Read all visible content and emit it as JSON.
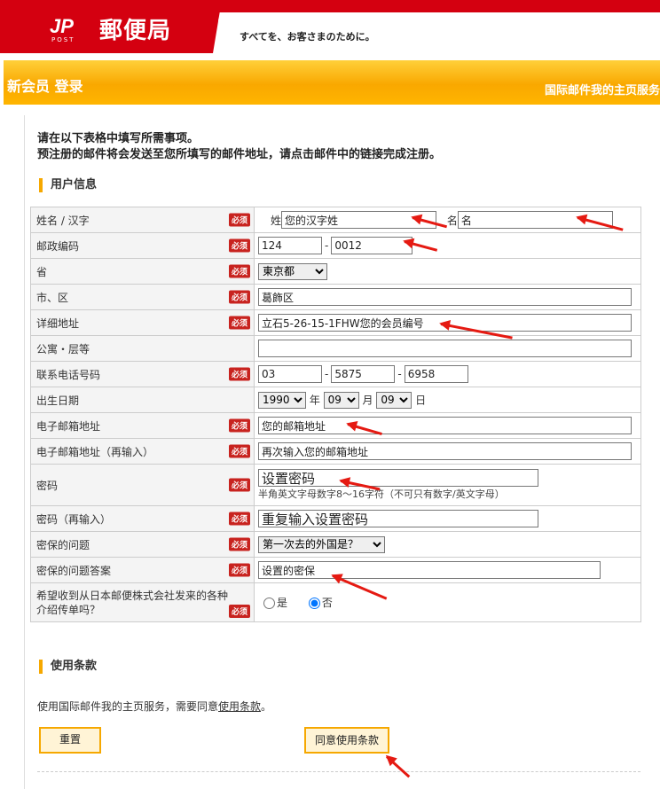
{
  "header": {
    "logo_mark": "JP",
    "logo_post": "POST",
    "logo_name": "郵便局",
    "slogan": "すべてを、お客さまのために。",
    "page_title": "新会员 登录",
    "right_link": "国际邮件我的主页服务"
  },
  "intro": {
    "line1": "请在以下表格中填写所需事项。",
    "line2": "预注册的邮件将会发送至您所填写的邮件地址，请点击邮件中的链接完成注册。"
  },
  "section_user": "用户信息",
  "required_label": "必须",
  "fields": {
    "name": {
      "label": "姓名 / 汉字",
      "last_prefix": "姓",
      "last_value": "您的汉字姓",
      "first_prefix": "名",
      "first_value": "名"
    },
    "postal": {
      "label": "邮政编码",
      "part1": "124",
      "part2": "0012",
      "sep": "-"
    },
    "prefecture": {
      "label": "省",
      "value": "東京都"
    },
    "city": {
      "label": "市、区",
      "value": "葛飾区"
    },
    "address": {
      "label": "详细地址",
      "value": "立石5-26-15-1FHW您的会员编号"
    },
    "apartment": {
      "label": "公寓・层等",
      "value": ""
    },
    "phone": {
      "label": "联系电话号码",
      "part1": "03",
      "part2": "5875",
      "part3": "6958",
      "sep": "-"
    },
    "birth": {
      "label": "出生日期",
      "year": "1990",
      "year_unit": "年",
      "month": "09",
      "month_unit": "月",
      "day": "09",
      "day_unit": "日"
    },
    "email": {
      "label": "电子邮箱地址",
      "value": "您的邮箱地址"
    },
    "email_confirm": {
      "label": "电子邮箱地址（再输入）",
      "value": "再次输入您的邮箱地址"
    },
    "password": {
      "label": "密码",
      "value": "设置密码",
      "hint": "半角英文字母数字8～16字符（不可只有数字/英文字母）"
    },
    "password_confirm": {
      "label": "密码（再输入）",
      "value": "重复输入设置密码"
    },
    "security_question": {
      "label": "密保的问题",
      "value": "第一次去的外国是？"
    },
    "security_answer": {
      "label": "密保的问题答案",
      "value": "设置的密保"
    },
    "newsletter": {
      "label": "希望收到从日本邮便株式会社发来的各种介绍传单吗？",
      "yes": "是",
      "no": "否",
      "selected": "no"
    }
  },
  "section_terms": "使用条款",
  "terms": {
    "text_before": "使用国际邮件我的主页服务，需要同意",
    "link": "使用条款",
    "text_after": "。"
  },
  "buttons": {
    "reset": "重置",
    "agree": "同意使用条款"
  },
  "colors": {
    "brand_red": "#d40010",
    "orange": "#f9a800",
    "annotation_red": "#e51a12"
  }
}
